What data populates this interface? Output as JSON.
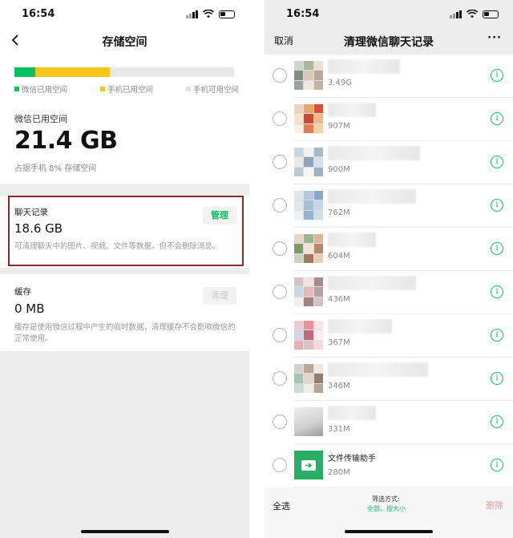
{
  "status": {
    "time": "16:54"
  },
  "storage": {
    "title": "存储空间",
    "legend": {
      "wechat_used": "微信已用空间",
      "phone_used": "手机已用空间",
      "phone_free": "手机可用空间"
    },
    "usage_fractions": {
      "wechat_used": 0.095,
      "phone_used": 0.34
    },
    "colors": {
      "wechat_used": "#07c160",
      "phone_used": "#f5c518",
      "phone_free": "#e8e8e8",
      "highlight_box": "#8a2a2a"
    },
    "used_label": "微信已用空间",
    "used_value": "21.4 GB",
    "used_percent": "占据手机 8% 存储空间",
    "chat": {
      "title": "聊天记录",
      "value": "18.6 GB",
      "button": "管理",
      "desc": "可清理聊天中的图片、视频、文件等数据，但不会删除消息。"
    },
    "cache": {
      "title": "缓存",
      "value": "0 MB",
      "button": "清理",
      "desc": "缓存是使用微信过程中产生的临时数据，清理缓存不会影响微信的正常使用。"
    }
  },
  "clean": {
    "cancel": "取消",
    "title": "清理微信聊天记录",
    "more": "···",
    "items": [
      {
        "name": "",
        "size": "3.49G"
      },
      {
        "name": "",
        "size": "907M"
      },
      {
        "name": "",
        "size": "900M"
      },
      {
        "name": "",
        "size": "762M"
      },
      {
        "name": "",
        "size": "604M"
      },
      {
        "name": "",
        "size": "436M"
      },
      {
        "name": "",
        "size": "367M"
      },
      {
        "name": "",
        "size": "346M"
      },
      {
        "name": "",
        "size": "331M"
      },
      {
        "name": "文件传输助手",
        "size": "280M"
      }
    ],
    "info_icon": "i",
    "select_all": "全选",
    "filter_label": "筛选方式:",
    "filter_value": "全部、按大小",
    "delete": "删除"
  }
}
